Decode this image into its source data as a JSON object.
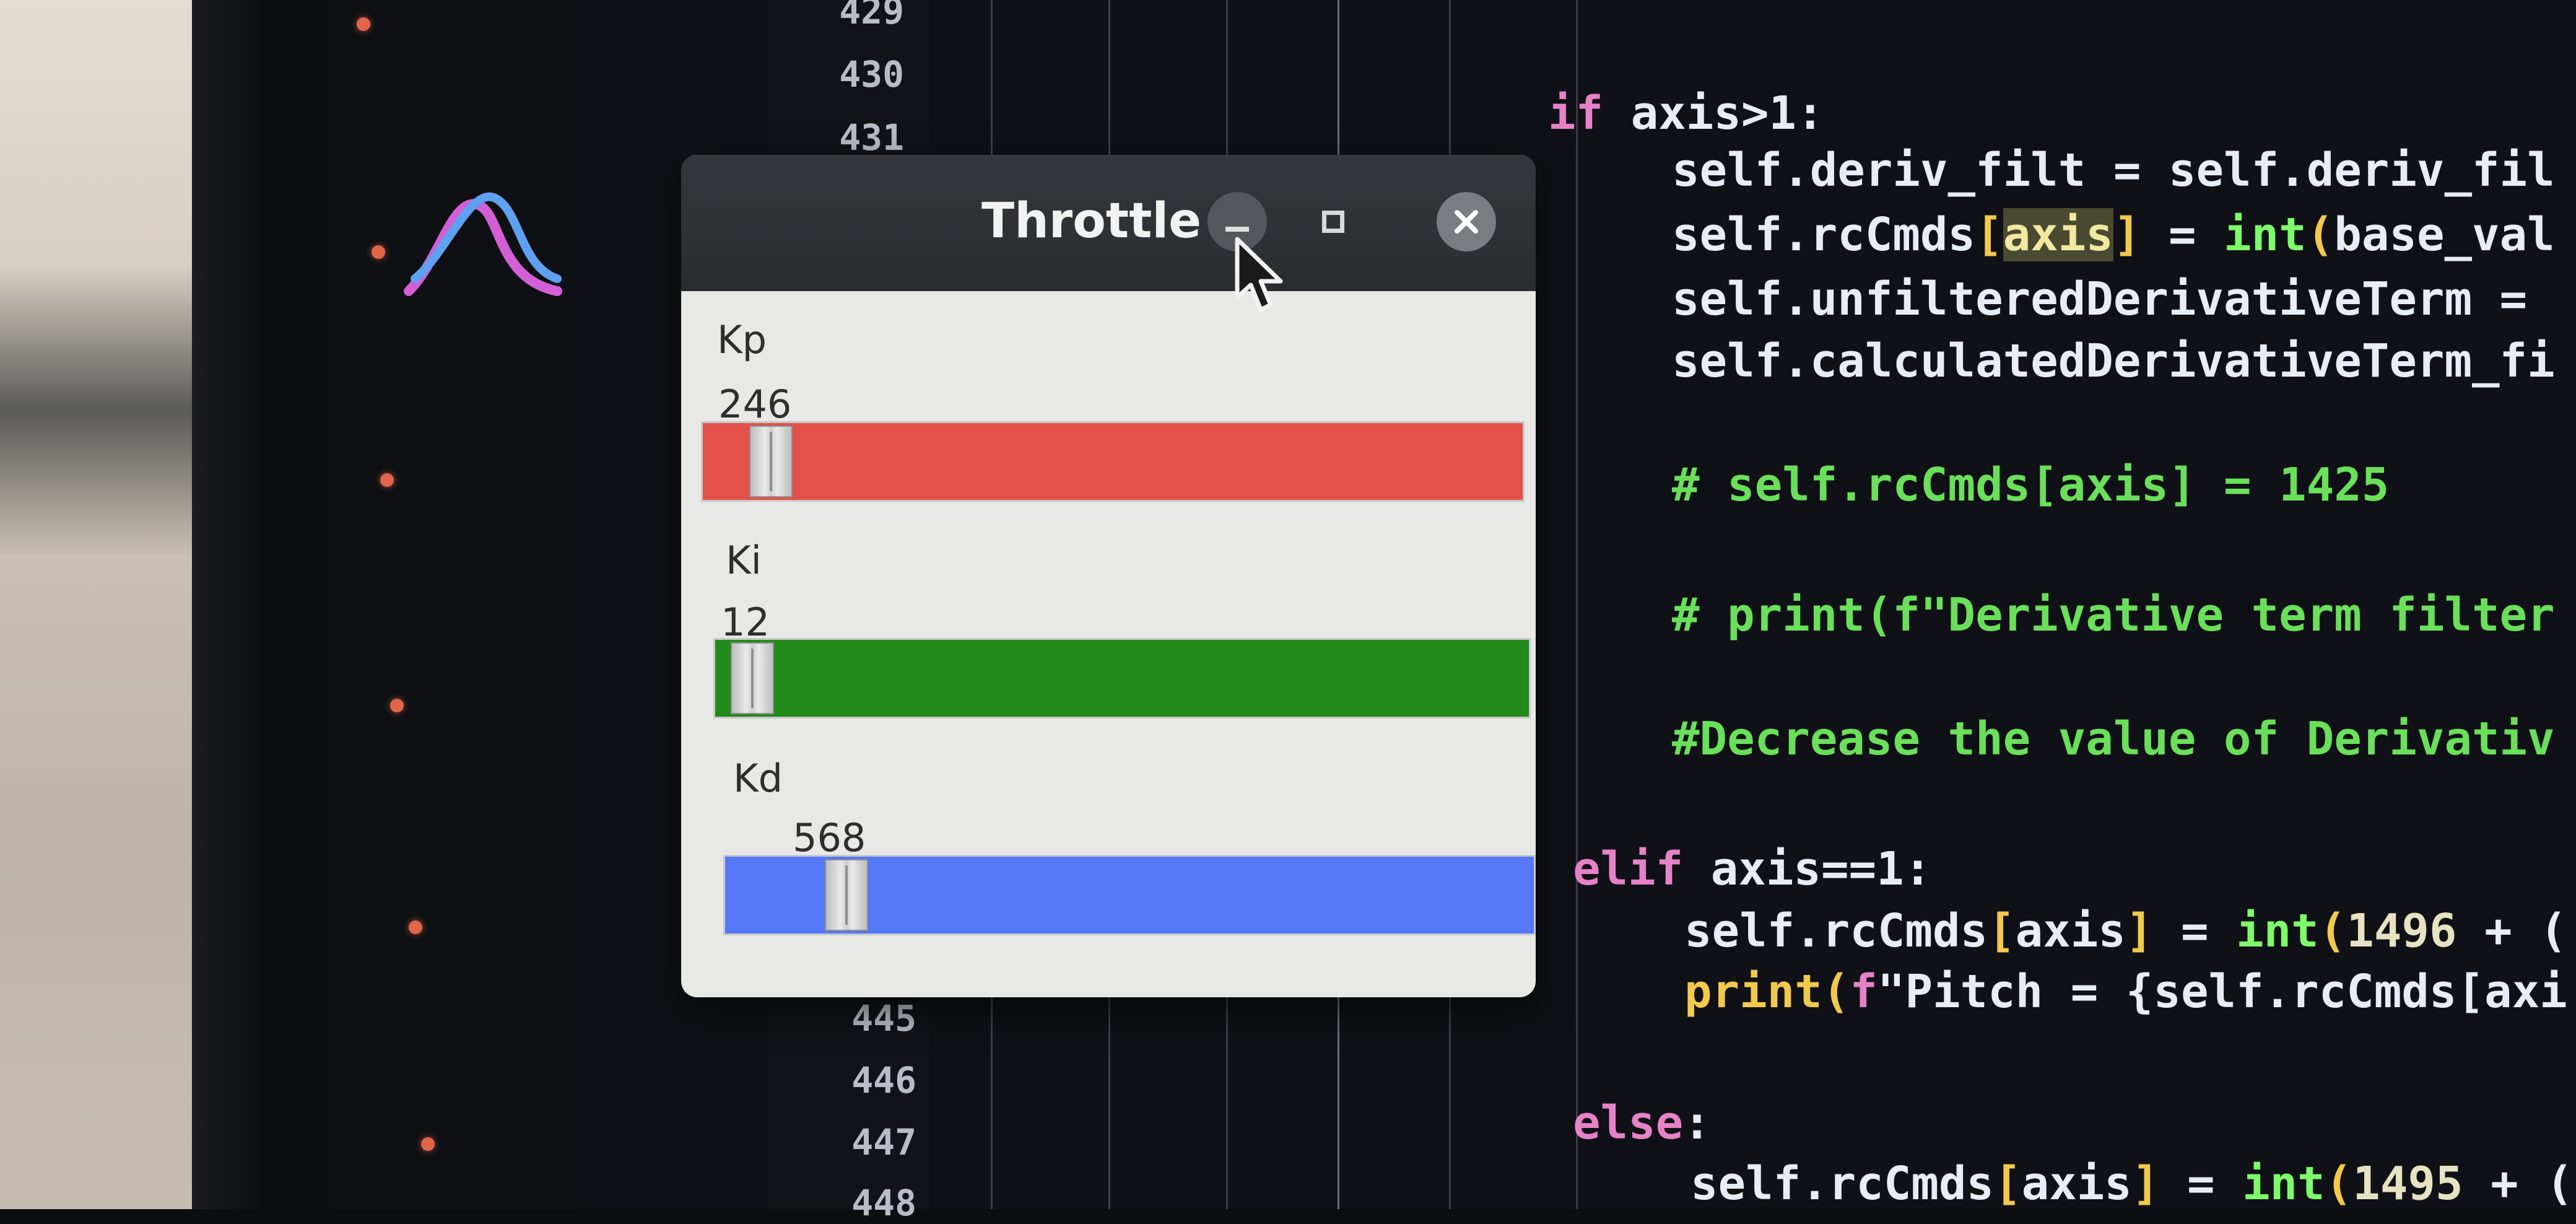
{
  "window": {
    "title": "Throttle",
    "controls": {
      "minimize_icon": "minimize-icon",
      "maximize_icon": "maximize-icon",
      "close_icon": "close-icon"
    }
  },
  "sliders": [
    {
      "label": "Kp",
      "value": "246",
      "color": "#e4504a",
      "level": 0.06
    },
    {
      "label": "Ki",
      "value": "12",
      "color": "#238a1c",
      "level": 0.02
    },
    {
      "label": "Kd",
      "value": "568",
      "color": "#5578f6",
      "level": 0.13
    }
  ],
  "editor": {
    "line_numbers_top": [
      "429",
      "430",
      "431"
    ],
    "line_numbers_bottom": [
      "445",
      "446",
      "447",
      "448"
    ],
    "accent_dot_color": "#e0654a"
  }
}
